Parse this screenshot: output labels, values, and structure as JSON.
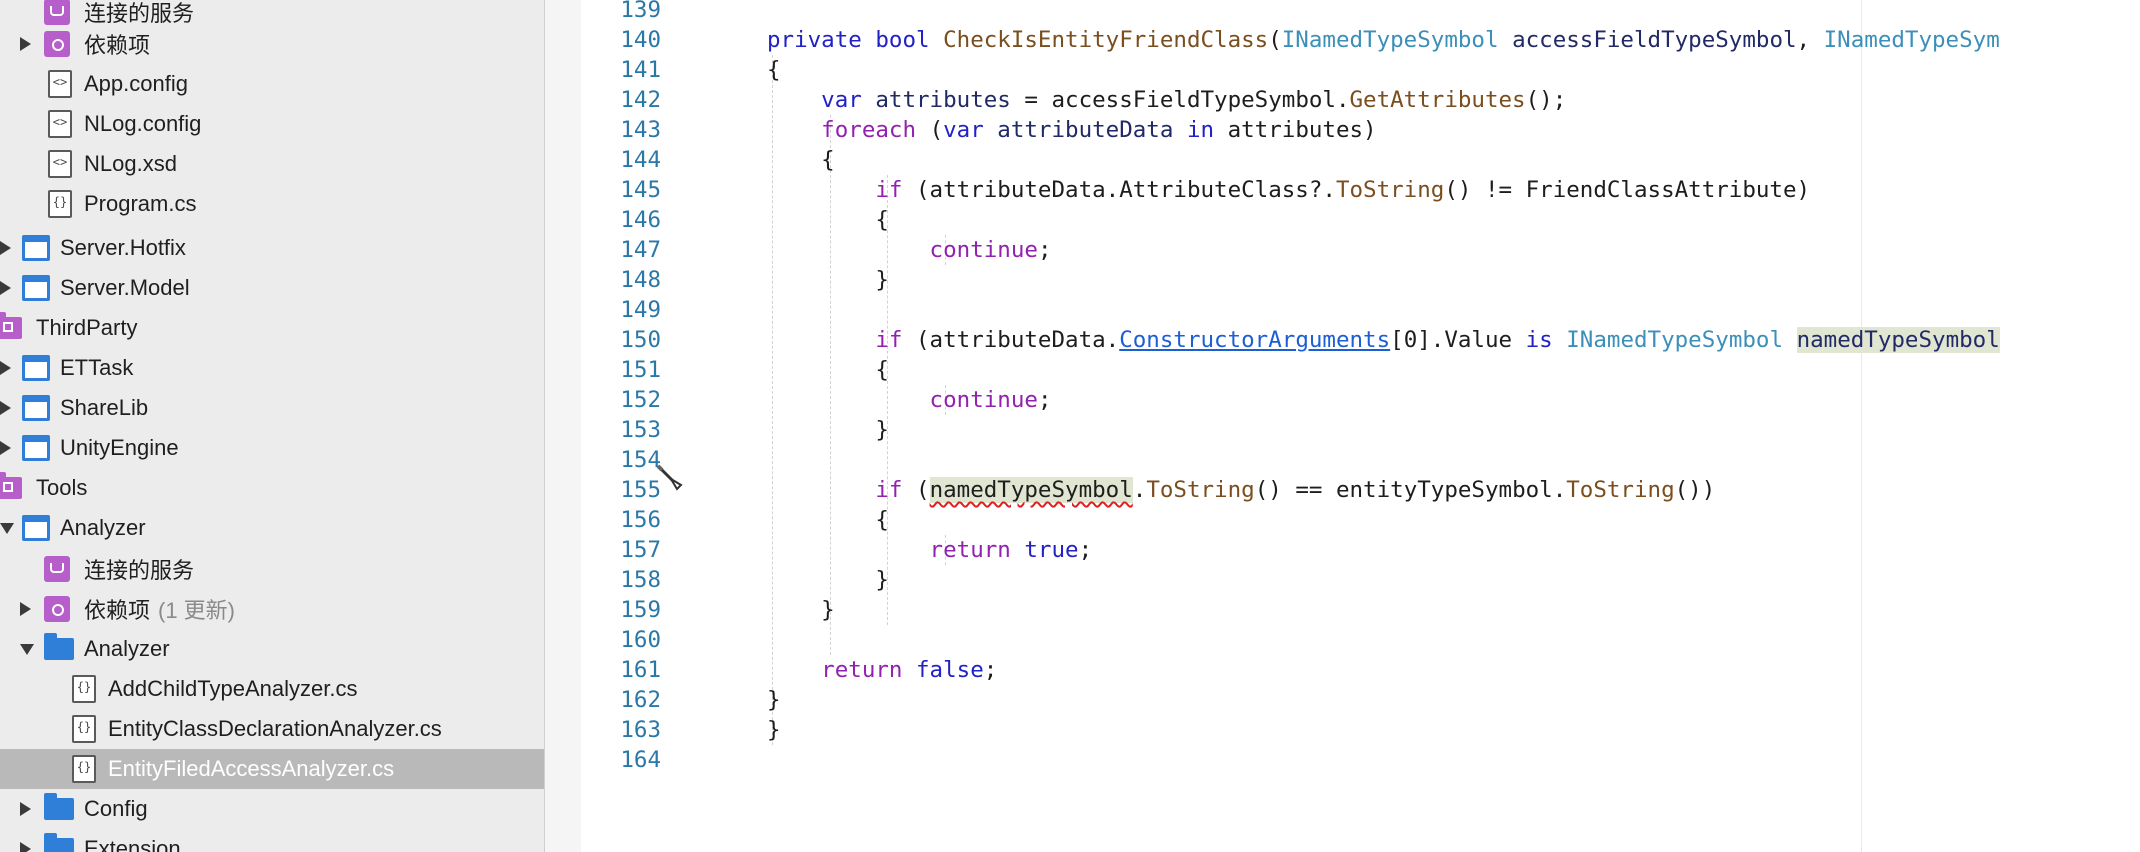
{
  "sidebar": {
    "items": [
      {
        "label": "连接的服务",
        "note": "",
        "icon": "connected-services-icon"
      },
      {
        "label": "依赖项",
        "note": "",
        "icon": "dependencies-icon"
      },
      {
        "label": "App.config",
        "note": "",
        "icon": "config-file-icon"
      },
      {
        "label": "NLog.config",
        "note": "",
        "icon": "config-file-icon"
      },
      {
        "label": "NLog.xsd",
        "note": "",
        "icon": "xml-file-icon"
      },
      {
        "label": "Program.cs",
        "note": "",
        "icon": "csharp-file-icon"
      },
      {
        "label": "Server.Hotfix",
        "note": "",
        "icon": "project-icon"
      },
      {
        "label": "Server.Model",
        "note": "",
        "icon": "project-icon"
      },
      {
        "label": "ThirdParty",
        "note": "",
        "icon": "solution-folder-icon"
      },
      {
        "label": "ETTask",
        "note": "",
        "icon": "project-icon"
      },
      {
        "label": "ShareLib",
        "note": "",
        "icon": "project-icon"
      },
      {
        "label": "UnityEngine",
        "note": "",
        "icon": "project-icon"
      },
      {
        "label": "Tools",
        "note": "",
        "icon": "solution-folder-icon"
      },
      {
        "label": "Analyzer",
        "note": "",
        "icon": "project-icon"
      },
      {
        "label": "连接的服务",
        "note": "",
        "icon": "connected-services-icon"
      },
      {
        "label": "依赖项",
        "note": "(1 更新)",
        "icon": "dependencies-icon"
      },
      {
        "label": "Analyzer",
        "note": "",
        "icon": "folder-icon"
      },
      {
        "label": "AddChildTypeAnalyzer.cs",
        "note": "",
        "icon": "csharp-file-icon"
      },
      {
        "label": "EntityClassDeclarationAnalyzer.cs",
        "note": "",
        "icon": "csharp-file-icon"
      },
      {
        "label": "EntityFiledAccessAnalyzer.cs",
        "note": "",
        "icon": "csharp-file-icon"
      },
      {
        "label": "Config",
        "note": "",
        "icon": "folder-icon"
      },
      {
        "label": "Extension",
        "note": "",
        "icon": "folder-icon"
      }
    ],
    "selected_item": "EntityFiledAccessAnalyzer.cs"
  },
  "editor": {
    "lines": [
      {
        "n": "139",
        "tokens": []
      },
      {
        "n": "140",
        "tokens": [
          [
            "private ",
            "kw"
          ],
          [
            "bool ",
            "kw"
          ],
          [
            "CheckIsEntityFriendClass",
            "me"
          ],
          [
            "(",
            ""
          ],
          [
            "INamedTypeSymbol ",
            "ty"
          ],
          [
            "accessFieldTypeSymbol",
            "pa"
          ],
          [
            ", ",
            ""
          ],
          [
            "INamedTypeSym",
            "ty"
          ]
        ]
      },
      {
        "n": "141",
        "tokens": [
          [
            "{",
            ""
          ]
        ]
      },
      {
        "n": "142",
        "tokens": [
          [
            "    var ",
            "kw"
          ],
          [
            "attributes ",
            "pa"
          ],
          [
            "= accessFieldTypeSymbol.",
            ""
          ],
          [
            "GetAttributes",
            "me"
          ],
          [
            "();",
            ""
          ]
        ]
      },
      {
        "n": "143",
        "tokens": [
          [
            "    foreach ",
            "kw2"
          ],
          [
            "(",
            ""
          ],
          [
            "var ",
            "kw"
          ],
          [
            "attributeData ",
            "pa"
          ],
          [
            "in ",
            "kw"
          ],
          [
            "attributes)",
            ""
          ]
        ]
      },
      {
        "n": "144",
        "tokens": [
          [
            "    {",
            ""
          ]
        ]
      },
      {
        "n": "145",
        "tokens": [
          [
            "        if ",
            "kw2"
          ],
          [
            "(attributeData.AttributeClass?.",
            ""
          ],
          [
            "ToString",
            "me"
          ],
          [
            "() != FriendClassAttribute)",
            ""
          ]
        ]
      },
      {
        "n": "146",
        "tokens": [
          [
            "        {",
            ""
          ]
        ]
      },
      {
        "n": "147",
        "tokens": [
          [
            "            continue",
            "kw2"
          ],
          [
            ";",
            ""
          ]
        ]
      },
      {
        "n": "148",
        "tokens": [
          [
            "        }",
            ""
          ]
        ]
      },
      {
        "n": "149",
        "tokens": []
      },
      {
        "n": "150",
        "tokens": [
          [
            "        if ",
            "kw2"
          ],
          [
            "(attributeData.",
            ""
          ],
          [
            "ConstructorArguments",
            "link"
          ],
          [
            "[0].Value ",
            ""
          ],
          [
            "is ",
            "kw"
          ],
          [
            "INamedTypeSymbol ",
            "ty"
          ],
          [
            "namedTypeSymbol",
            "pa hl"
          ]
        ]
      },
      {
        "n": "151",
        "tokens": [
          [
            "        {",
            ""
          ]
        ]
      },
      {
        "n": "152",
        "tokens": [
          [
            "            continue",
            "kw2"
          ],
          [
            ";",
            ""
          ]
        ]
      },
      {
        "n": "153",
        "tokens": [
          [
            "        }",
            ""
          ]
        ]
      },
      {
        "n": "154",
        "tokens": []
      },
      {
        "n": "155",
        "tokens": [
          [
            "        if ",
            "kw2"
          ],
          [
            "(",
            ""
          ],
          [
            "namedTypeSymbol",
            "hl err"
          ],
          [
            ".",
            ""
          ],
          [
            "ToString",
            "me"
          ],
          [
            "() == entityTypeSymbol.",
            ""
          ],
          [
            "ToString",
            "me"
          ],
          [
            "())",
            ""
          ]
        ]
      },
      {
        "n": "156",
        "tokens": [
          [
            "        {",
            ""
          ]
        ]
      },
      {
        "n": "157",
        "tokens": [
          [
            "            return ",
            "kw2"
          ],
          [
            "true",
            "kw"
          ],
          [
            ";",
            ""
          ]
        ]
      },
      {
        "n": "158",
        "tokens": [
          [
            "        }",
            ""
          ]
        ]
      },
      {
        "n": "159",
        "tokens": [
          [
            "    }",
            ""
          ]
        ]
      },
      {
        "n": "160",
        "tokens": []
      },
      {
        "n": "161",
        "tokens": [
          [
            "    return ",
            "kw2"
          ],
          [
            "false",
            "kw"
          ],
          [
            ";",
            ""
          ]
        ]
      },
      {
        "n": "162",
        "tokens": [
          [
            "}",
            ""
          ]
        ]
      },
      {
        "n": "163",
        "tokens": [
          [
            "}",
            ""
          ]
        ]
      },
      {
        "n": "164",
        "tokens": []
      }
    ]
  },
  "colors": {
    "keyword": "#2121c6",
    "control_keyword": "#9321b0",
    "type": "#3b8fb8",
    "method": "#7a4e1e",
    "line_number": "#2a78a8",
    "selection": "#b9b9b9"
  }
}
